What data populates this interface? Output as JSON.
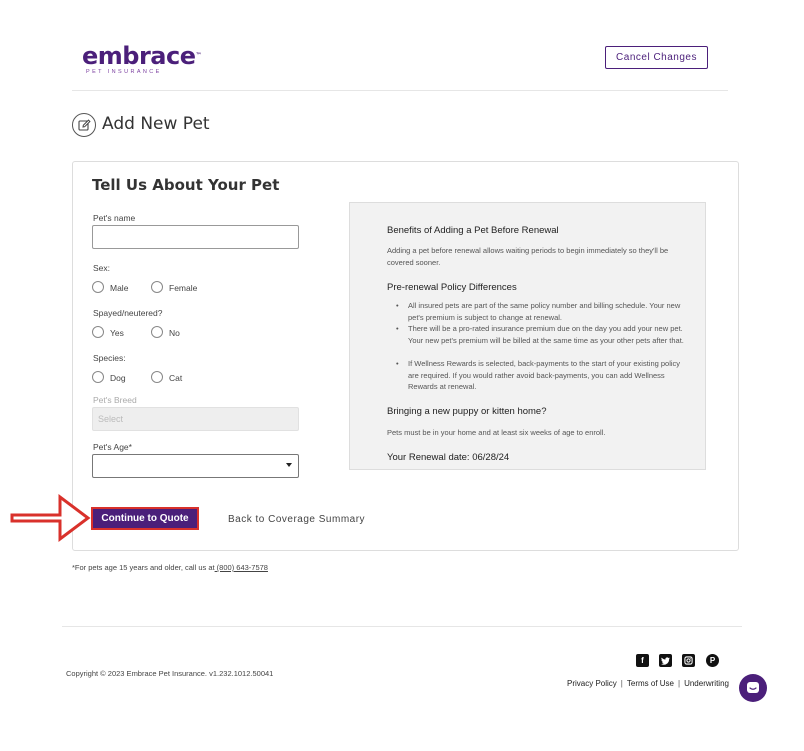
{
  "header": {
    "logo_main": "embrace",
    "logo_tm": "™",
    "logo_sub": "PET INSURANCE",
    "cancel_label": "Cancel Changes"
  },
  "page": {
    "title": "Add New Pet",
    "icon": "edit-icon"
  },
  "form": {
    "title": "Tell Us About Your Pet",
    "pet_name_label": "Pet's name",
    "pet_name_value": "",
    "sex_label": "Sex:",
    "sex_options": [
      "Male",
      "Female"
    ],
    "spayed_label": "Spayed/neutered?",
    "spayed_options": [
      "Yes",
      "No"
    ],
    "species_label": "Species:",
    "species_options": [
      "Dog",
      "Cat"
    ],
    "breed_label": "Pet's Breed",
    "breed_placeholder": "Select",
    "age_label": "Pet's Age*",
    "age_value": ""
  },
  "info": {
    "h1": "Benefits of Adding a Pet Before Renewal",
    "p1": "Adding a pet before renewal allows waiting periods to begin immediately so they'll be covered sooner.",
    "h2": "Pre-renewal Policy Differences",
    "bullets": [
      "All insured pets are part of the same policy number and billing schedule. Your new pet's premium is subject to change at renewal.",
      "There will be a pro-rated insurance premium due on the day you add your new pet. Your new pet's premium will be billed at the same time as your other pets after that.",
      "If Wellness Rewards is selected, back-payments to the start of your existing policy are required. If you would rather avoid back-payments, you can add Wellness Rewards at renewal."
    ],
    "h3": "Bringing a new puppy or kitten home?",
    "p3": "Pets must be in your home and at least six weeks of age to enroll.",
    "renewal": "Your Renewal date: 06/28/24"
  },
  "actions": {
    "continue_label": "Continue to Quote",
    "back_label": "Back to Coverage Summary"
  },
  "footnote": {
    "text": "*For pets age 15 years and older, call us at",
    "phone": " (800) 643-7578"
  },
  "footer": {
    "copyright": "Copyright © 2023   Embrace Pet Insurance. v1.232.1012.50041",
    "links": [
      "Privacy Policy",
      "Terms of Use",
      "Underwriting"
    ],
    "social": [
      "facebook-icon",
      "twitter-icon",
      "instagram-icon",
      "pinterest-icon"
    ]
  },
  "colors": {
    "brand": "#4b1f7a",
    "annotation_arrow": "#d9312b"
  }
}
